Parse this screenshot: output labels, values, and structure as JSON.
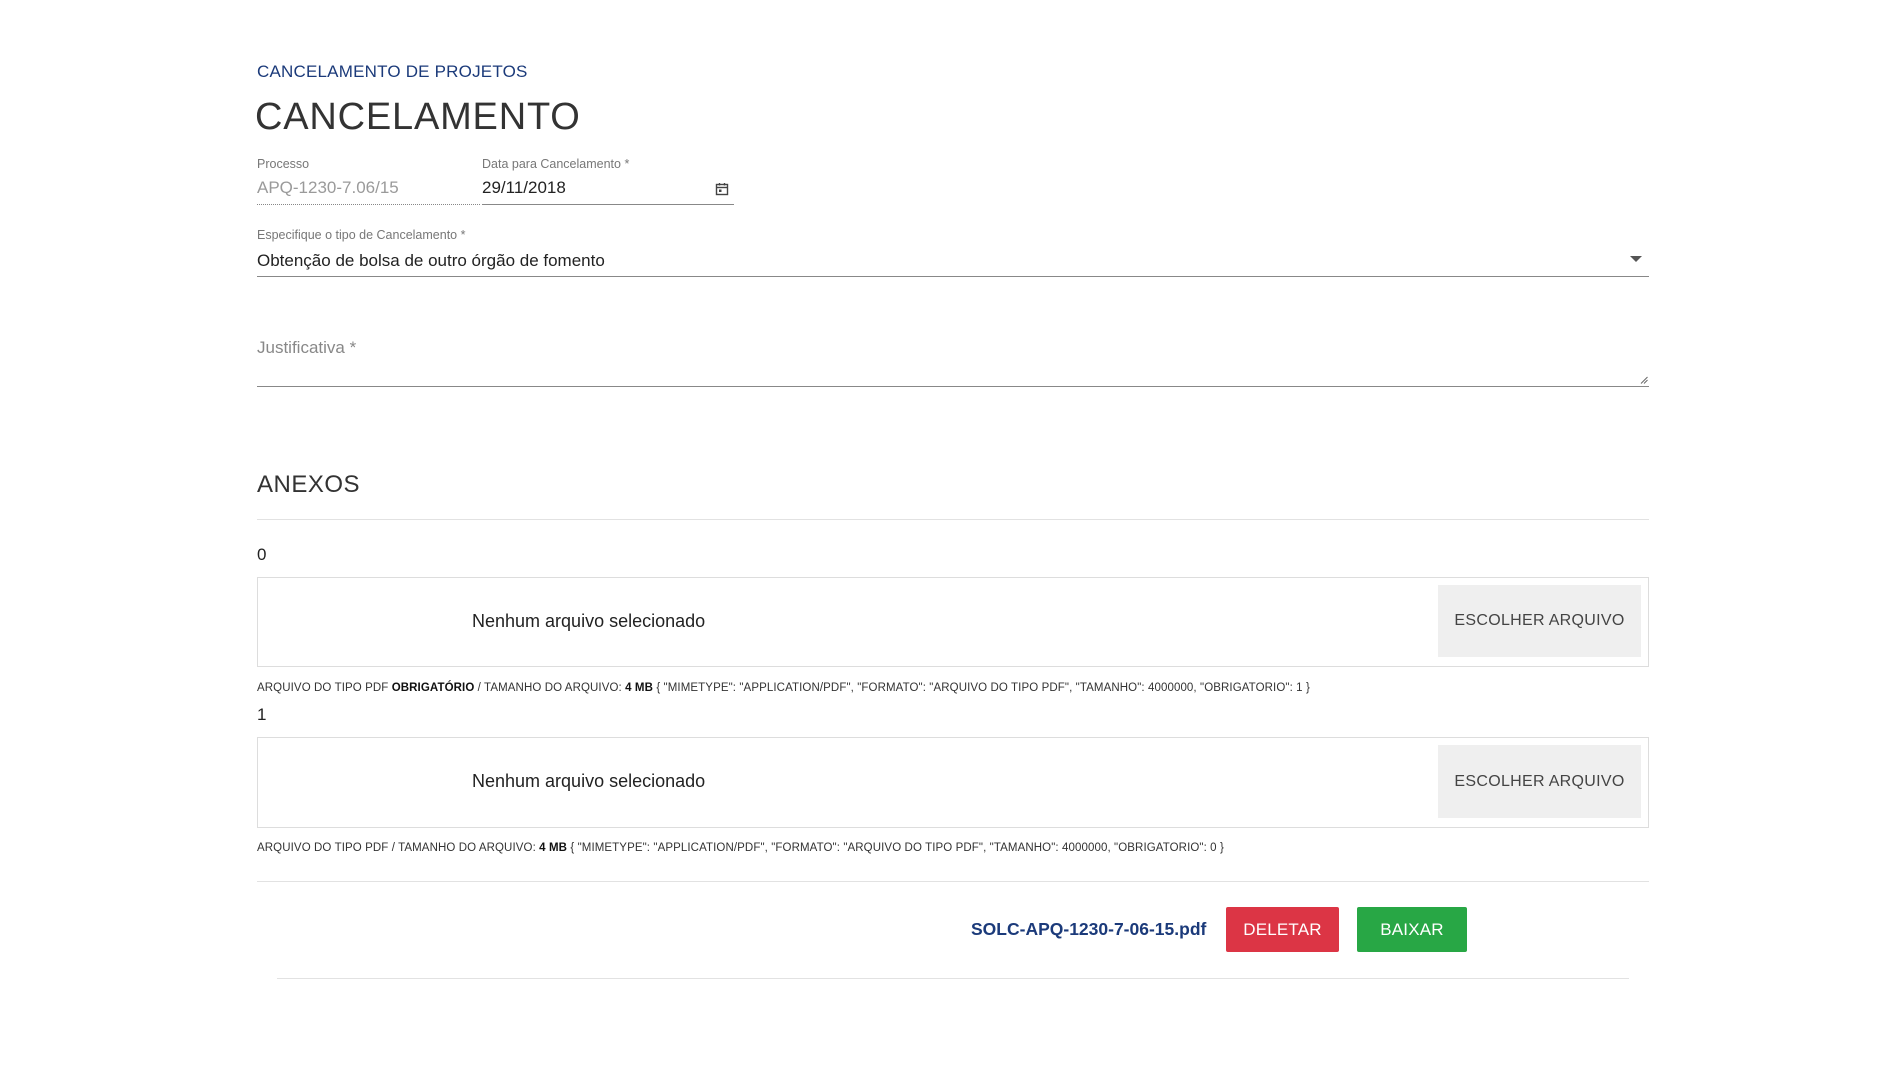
{
  "breadcrumb": "CANCELAMENTO DE PROJETOS",
  "page_title": "CANCELAMENTO",
  "processo": {
    "label": "Processo",
    "value": "APQ-1230-7.06/15"
  },
  "data_cancelamento": {
    "label": "Data para Cancelamento *",
    "value": "29/11/2018",
    "icon": "calendar-icon"
  },
  "tipo_cancelamento": {
    "label": "Especifique o tipo de Cancelamento *",
    "value": "Obtenção de bolsa de outro órgão de fomento",
    "icon": "chevron-down-icon"
  },
  "justificativa": {
    "placeholder": "Justificativa *",
    "value": ""
  },
  "anexos": {
    "title": "ANEXOS",
    "items": [
      {
        "index": "0",
        "file_name": "Nenhum arquivo selecionado",
        "button_label": "ESCOLHER ARQUIVO",
        "help_prefix": "ARQUIVO DO TIPO PDF ",
        "help_required": "OBRIGATÓRIO",
        "help_middle": " / TAMANHO DO ARQUIVO: ",
        "help_size": "4 MB",
        "help_suffix": " { \"MIMETYPE\": \"APPLICATION/PDF\", \"FORMATO\": \"ARQUIVO DO TIPO PDF\", \"TAMANHO\": 4000000, \"OBRIGATORIO\": 1 }"
      },
      {
        "index": "1",
        "file_name": "Nenhum arquivo selecionado",
        "button_label": "ESCOLHER ARQUIVO",
        "help_prefix": "ARQUIVO DO TIPO PDF / TAMANHO DO ARQUIVO: ",
        "help_size": "4 MB",
        "help_suffix": " { \"MIMETYPE\": \"APPLICATION/PDF\", \"FORMATO\": \"ARQUIVO DO TIPO PDF\", \"TAMANHO\": 4000000, \"OBRIGATORIO\": 0 }"
      }
    ]
  },
  "uploaded": {
    "file_name": "SOLC-APQ-1230-7-06-15.pdf",
    "delete_label": "DELETAR",
    "download_label": "BAIXAR"
  },
  "colors": {
    "brand_blue": "#1b3a7a",
    "delete_red": "#dc3545",
    "download_green": "#28a745"
  }
}
